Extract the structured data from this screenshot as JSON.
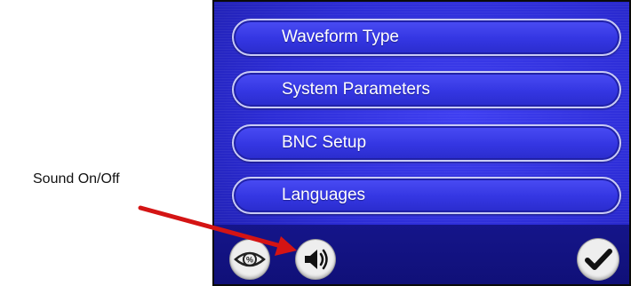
{
  "annotation": {
    "label": "Sound On/Off",
    "arrow_color": "#d41414"
  },
  "menu": {
    "items": [
      {
        "label": "Waveform Type"
      },
      {
        "label": "System Parameters"
      },
      {
        "label": "BNC Setup"
      },
      {
        "label": "Languages"
      }
    ]
  },
  "bottom_bar": {
    "icons": [
      "eye-percent-icon",
      "speaker-icon",
      "checkmark-icon"
    ]
  },
  "colors": {
    "screen_blue": "#2c2cd6",
    "bar_blue": "#15158a",
    "button_border": "#c9cbf5"
  }
}
